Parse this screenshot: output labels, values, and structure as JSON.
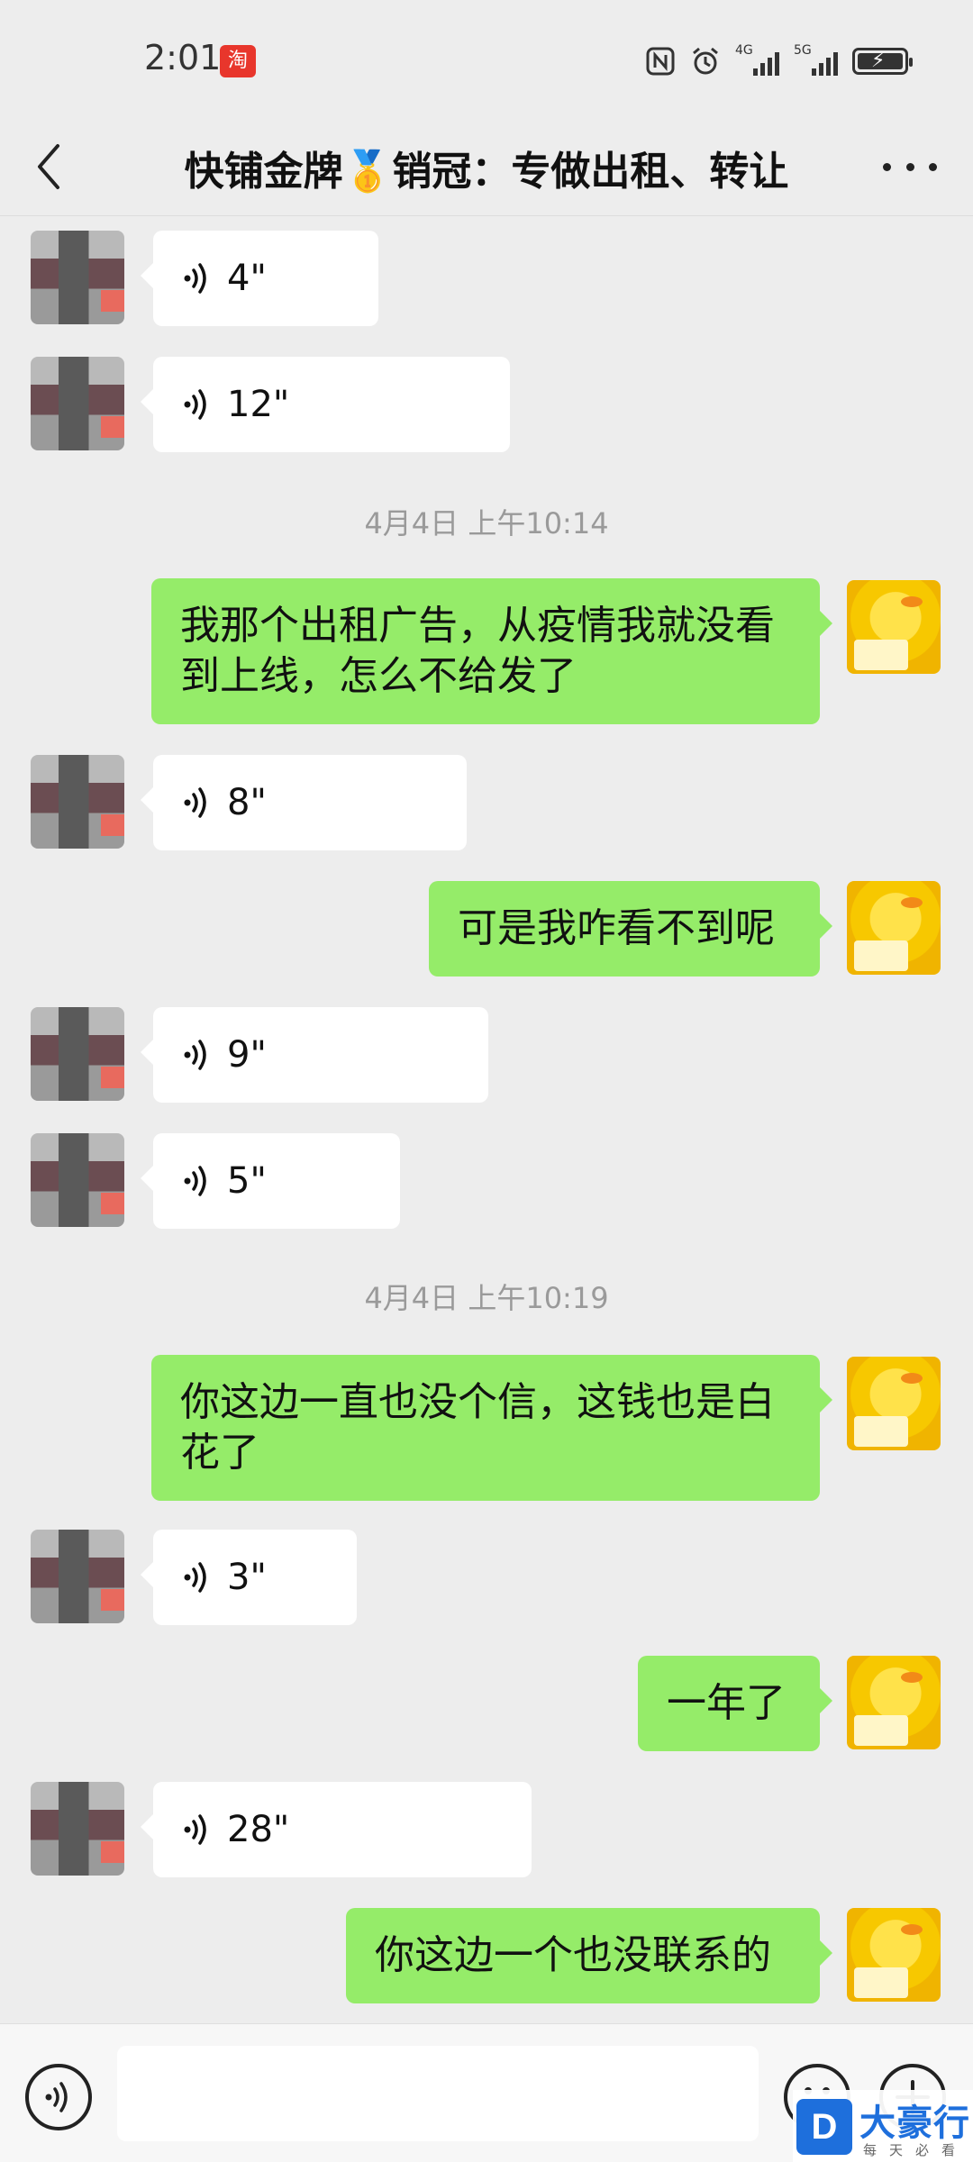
{
  "status_bar": {
    "time": "2:01",
    "app_badge": "淘",
    "signal_1": "4G",
    "signal_2": "5G"
  },
  "header": {
    "title": "快铺金牌🥇销冠：专做出租、转让"
  },
  "messages": [
    {
      "type": "voice",
      "from": "other",
      "duration": "4\""
    },
    {
      "type": "voice",
      "from": "other",
      "duration": "12\""
    },
    {
      "type": "timestamp",
      "text": "4月4日 上午10:14"
    },
    {
      "type": "text",
      "from": "self",
      "text": "我那个出租广告，从疫情我就没看到上线，怎么不给发了"
    },
    {
      "type": "voice",
      "from": "other",
      "duration": "8\""
    },
    {
      "type": "text",
      "from": "self",
      "text": "可是我咋看不到呢"
    },
    {
      "type": "voice",
      "from": "other",
      "duration": "9\""
    },
    {
      "type": "voice",
      "from": "other",
      "duration": "5\""
    },
    {
      "type": "timestamp",
      "text": "4月4日 上午10:19"
    },
    {
      "type": "text",
      "from": "self",
      "text": "你这边一直也没个信，这钱也是白花了"
    },
    {
      "type": "voice",
      "from": "other",
      "duration": "3\""
    },
    {
      "type": "text",
      "from": "self",
      "text": "一年了"
    },
    {
      "type": "voice",
      "from": "other",
      "duration": "28\""
    },
    {
      "type": "text",
      "from": "self",
      "text": "你这边一个也没联系的"
    }
  ],
  "input": {
    "placeholder": ""
  },
  "watermark": {
    "logo_letter": "D",
    "title": "大豪行",
    "subtitle": "每天必看"
  },
  "colors": {
    "self_bubble": "#95ec69",
    "other_bubble": "#ffffff",
    "background": "#ededed"
  }
}
